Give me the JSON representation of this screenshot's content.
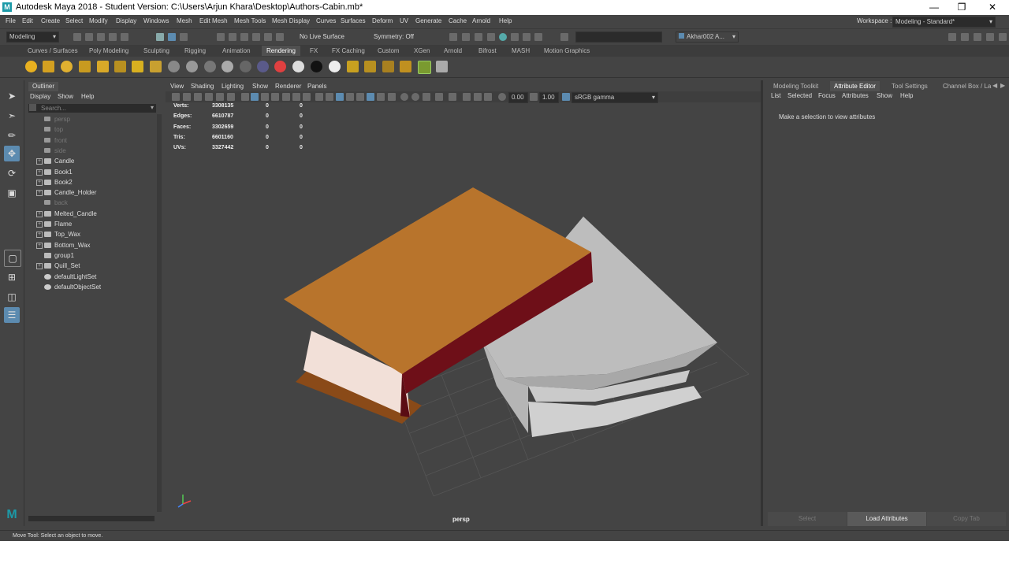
{
  "window": {
    "title": "Autodesk Maya 2018 - Student Version: C:\\Users\\Arjun Khara\\Desktop\\Authors-Cabin.mb*",
    "logo": "M",
    "controls": [
      "—",
      "❐",
      "✕"
    ]
  },
  "menubar": {
    "items": [
      "File",
      "Edit",
      "Create",
      "Select",
      "Modify",
      "Display",
      "Windows",
      "Mesh",
      "Edit Mesh",
      "Mesh Tools",
      "Mesh Display",
      "Curves",
      "Surfaces",
      "Deform",
      "UV",
      "Generate",
      "Cache",
      "Arnold",
      "Help"
    ],
    "workspace_label": "Workspace :",
    "workspace_value": "Modeling - Standard*"
  },
  "statusline": {
    "mode": "Modeling",
    "live_surface": "No Live Surface",
    "symmetry": "Symmetry: Off",
    "user": "Akhar002 A..."
  },
  "shelf": {
    "tabs": [
      "Curves / Surfaces",
      "Poly Modeling",
      "Sculpting",
      "Rigging",
      "Animation",
      "Rendering",
      "FX",
      "FX Caching",
      "Custom",
      "XGen",
      "Arnold",
      "Bifrost",
      "MASH",
      "Motion Graphics"
    ],
    "active_tab": "Rendering"
  },
  "outliner": {
    "tab": "Outliner",
    "menu": [
      "Display",
      "Show",
      "Help"
    ],
    "search_placeholder": "Search...",
    "items": [
      {
        "name": "persp",
        "type": "camera",
        "dim": true,
        "expand": false
      },
      {
        "name": "top",
        "type": "camera",
        "dim": true,
        "expand": false
      },
      {
        "name": "front",
        "type": "camera",
        "dim": true,
        "expand": false
      },
      {
        "name": "side",
        "type": "camera",
        "dim": true,
        "expand": false
      },
      {
        "name": "Candle",
        "type": "mesh",
        "dim": false,
        "expand": true
      },
      {
        "name": "Book1",
        "type": "mesh",
        "dim": false,
        "expand": true
      },
      {
        "name": "Book2",
        "type": "mesh",
        "dim": false,
        "expand": true
      },
      {
        "name": "Candle_Holder",
        "type": "mesh",
        "dim": false,
        "expand": true
      },
      {
        "name": "back",
        "type": "camera",
        "dim": true,
        "expand": false
      },
      {
        "name": "Melted_Candle",
        "type": "mesh",
        "dim": false,
        "expand": true
      },
      {
        "name": "Flame",
        "type": "mesh",
        "dim": false,
        "expand": true
      },
      {
        "name": "Top_Wax",
        "type": "mesh",
        "dim": false,
        "expand": true
      },
      {
        "name": "Bottom_Wax",
        "type": "mesh",
        "dim": false,
        "expand": true
      },
      {
        "name": "group1",
        "type": "group",
        "dim": false,
        "expand": false
      },
      {
        "name": "Quill_Set",
        "type": "group",
        "dim": false,
        "expand": true
      },
      {
        "name": "defaultLightSet",
        "type": "set",
        "dim": false,
        "expand": false
      },
      {
        "name": "defaultObjectSet",
        "type": "set",
        "dim": false,
        "expand": false
      }
    ]
  },
  "viewport": {
    "menu": [
      "View",
      "Shading",
      "Lighting",
      "Show",
      "Renderer",
      "Panels"
    ],
    "exposure": "0.00",
    "gamma": "1.00",
    "color_space": "sRGB gamma",
    "camera_label": "persp",
    "hud": [
      {
        "label": "Verts:",
        "v1": "3308135",
        "v2": "0",
        "v3": "0"
      },
      {
        "label": "Edges:",
        "v1": "6610787",
        "v2": "0",
        "v3": "0"
      },
      {
        "label": "Faces:",
        "v1": "3302659",
        "v2": "0",
        "v3": "0"
      },
      {
        "label": "Tris:",
        "v1": "6601160",
        "v2": "0",
        "v3": "0"
      },
      {
        "label": "UVs:",
        "v1": "3327442",
        "v2": "0",
        "v3": "0"
      }
    ]
  },
  "attribute_editor": {
    "tabs": [
      "Modeling Toolkit",
      "Attribute Editor",
      "Tool Settings",
      "Channel Box / La"
    ],
    "active_tab": "Attribute Editor",
    "menu": [
      "List",
      "Selected",
      "Focus",
      "Attributes",
      "Show",
      "Help"
    ],
    "message": "Make a selection to view attributes",
    "buttons": [
      "Select",
      "Load Attributes",
      "Copy Tab"
    ]
  },
  "helpline": {
    "text": "Move Tool: Select an object to move."
  },
  "colors": {
    "accent": "#1c9aa8",
    "book_cover": "#b8742c",
    "book_spine": "#6e0f18",
    "block": "#c8c8c8"
  }
}
